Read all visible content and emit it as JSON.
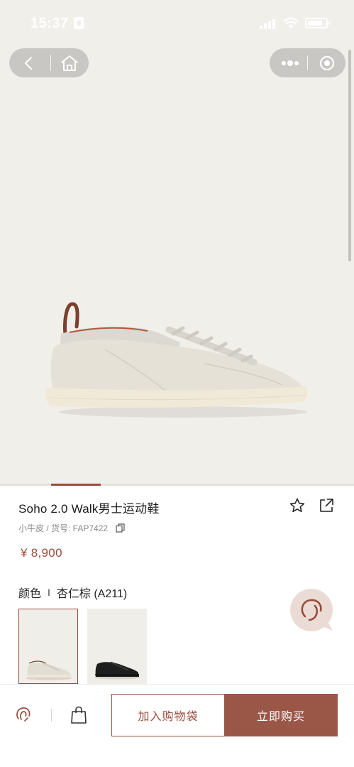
{
  "status_bar": {
    "time": "15:37"
  },
  "product": {
    "title": "Soho 2.0 Walk男士运动鞋",
    "meta": "小牛皮 / 货号: FAP7422",
    "price": "¥ 8,900",
    "gallery": {
      "current": 1
    }
  },
  "color": {
    "label": "颜色",
    "separator": "I",
    "selected": "杏仁棕 (A211)",
    "swatches": [
      {
        "name": "杏仁棕",
        "selected": true
      },
      {
        "name": "黑色",
        "selected": false
      }
    ]
  },
  "bottom_bar": {
    "add_to_bag": "加入购物袋",
    "buy_now": "立即购买"
  },
  "icons": {
    "back": "back-arrow-icon",
    "home": "home-icon",
    "more": "more-dots-icon",
    "close": "target-close-icon",
    "favorite": "star-icon",
    "share": "share-icon",
    "copy": "copy-icon",
    "chat": "customer-service-chat-icon",
    "service": "headset-icon",
    "bag": "shopping-bag-icon"
  },
  "colors": {
    "accent": "#9a4d3b",
    "hero_background": "#f1efea"
  }
}
